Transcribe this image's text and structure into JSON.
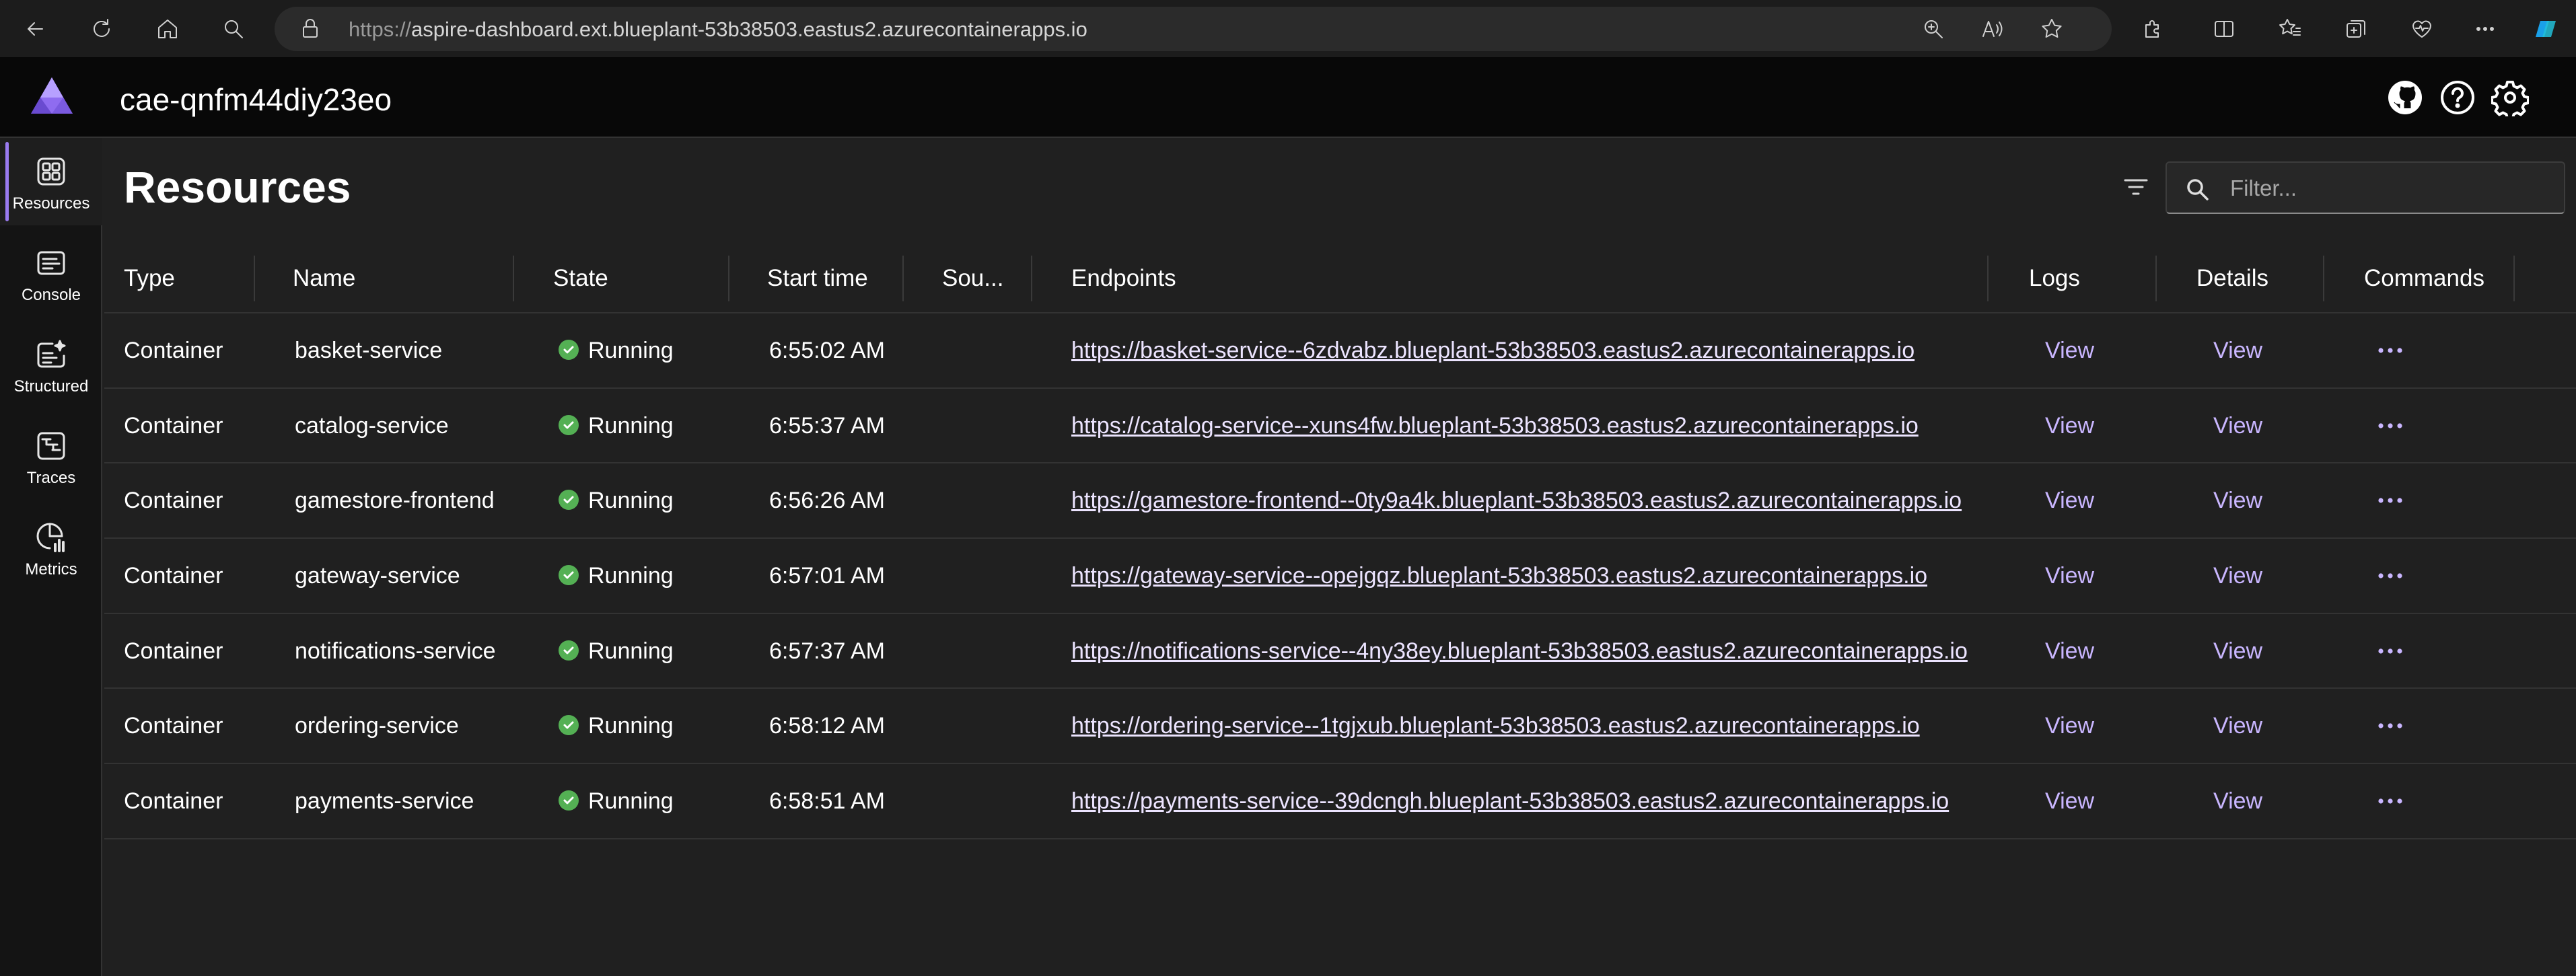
{
  "browser": {
    "url_protocol": "https://",
    "url_rest": "aspire-dashboard.ext.blueplant-53b38503.eastus2.azurecontainerapps.io"
  },
  "app": {
    "title": "cae-qnfm44diy23eo"
  },
  "sidebar": {
    "items": [
      {
        "label": "Resources",
        "icon": "grid-icon",
        "active": true
      },
      {
        "label": "Console",
        "icon": "console-icon",
        "active": false
      },
      {
        "label": "Structured",
        "icon": "structured-logs-icon",
        "active": false
      },
      {
        "label": "Traces",
        "icon": "traces-icon",
        "active": false
      },
      {
        "label": "Metrics",
        "icon": "metrics-icon",
        "active": false
      }
    ]
  },
  "main": {
    "title": "Resources",
    "filter_placeholder": "Filter..."
  },
  "table": {
    "columns": [
      "Type",
      "Name",
      "State",
      "Start time",
      "Sou...",
      "Endpoints",
      "Logs",
      "Details",
      "Commands"
    ],
    "rows": [
      {
        "type": "Container",
        "name": "basket-service",
        "state": "Running",
        "start": "6:55:02 AM",
        "endpoint": "https://basket-service--6zdvabz.blueplant-53b38503.eastus2.azurecontainerapps.io",
        "logs": "View",
        "details": "View"
      },
      {
        "type": "Container",
        "name": "catalog-service",
        "state": "Running",
        "start": "6:55:37 AM",
        "endpoint": "https://catalog-service--xuns4fw.blueplant-53b38503.eastus2.azurecontainerapps.io",
        "logs": "View",
        "details": "View"
      },
      {
        "type": "Container",
        "name": "gamestore-frontend",
        "state": "Running",
        "start": "6:56:26 AM",
        "endpoint": "https://gamestore-frontend--0ty9a4k.blueplant-53b38503.eastus2.azurecontainerapps.io",
        "logs": "View",
        "details": "View"
      },
      {
        "type": "Container",
        "name": "gateway-service",
        "state": "Running",
        "start": "6:57:01 AM",
        "endpoint": "https://gateway-service--opejgqz.blueplant-53b38503.eastus2.azurecontainerapps.io",
        "logs": "View",
        "details": "View"
      },
      {
        "type": "Container",
        "name": "notifications-service",
        "state": "Running",
        "start": "6:57:37 AM",
        "endpoint": "https://notifications-service--4ny38ey.blueplant-53b38503.eastus2.azurecontainerapps.io",
        "logs": "View",
        "details": "View"
      },
      {
        "type": "Container",
        "name": "ordering-service",
        "state": "Running",
        "start": "6:58:12 AM",
        "endpoint": "https://ordering-service--1tgjxub.blueplant-53b38503.eastus2.azurecontainerapps.io",
        "logs": "View",
        "details": "View"
      },
      {
        "type": "Container",
        "name": "payments-service",
        "state": "Running",
        "start": "6:58:51 AM",
        "endpoint": "https://payments-service--39dcngh.blueplant-53b38503.eastus2.azurecontainerapps.io",
        "logs": "View",
        "details": "View"
      }
    ]
  },
  "colors": {
    "accent": "#9a7bf0",
    "running": "#54b054",
    "link": "#ece4ff",
    "view_link": "#c9b6ff"
  }
}
